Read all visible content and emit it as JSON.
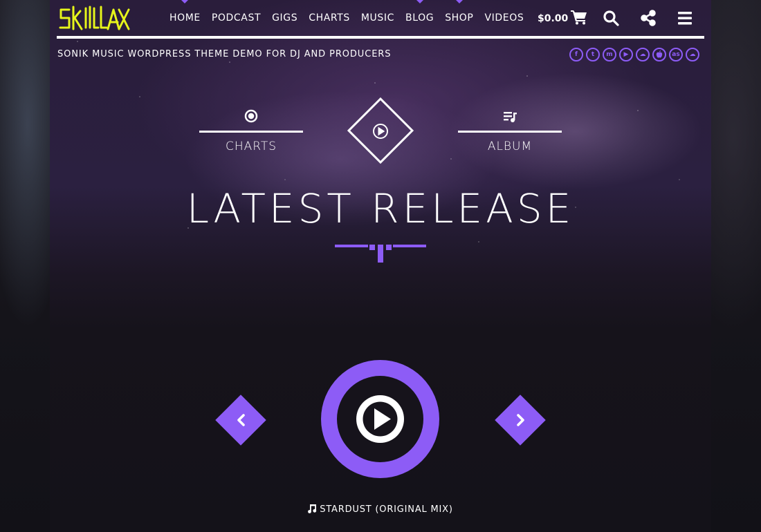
{
  "brand": {
    "logo_text": "SKILLAX"
  },
  "nav": {
    "items": [
      {
        "label": "HOME",
        "marked": true
      },
      {
        "label": "PODCAST",
        "marked": false
      },
      {
        "label": "GIGS",
        "marked": false
      },
      {
        "label": "CHARTS",
        "marked": false
      },
      {
        "label": "MUSIC",
        "marked": false
      },
      {
        "label": "BLOG",
        "marked": true
      },
      {
        "label": "SHOP",
        "marked": true
      },
      {
        "label": "VIDEOS",
        "marked": false
      }
    ]
  },
  "cart": {
    "total": "$0.00",
    "icon": "cart-icon"
  },
  "header_icons": [
    "search-icon",
    "share-icon",
    "menu-icon"
  ],
  "tagline": "SONIK MUSIC WORDPRESS THEME DEMO FOR DJ AND PRODUCERS",
  "socials": [
    {
      "name": "facebook-icon",
      "glyph": "f"
    },
    {
      "name": "twitter-icon",
      "glyph": "t"
    },
    {
      "name": "mixcloud-icon",
      "glyph": "m"
    },
    {
      "name": "youtube-icon",
      "glyph": "▶"
    },
    {
      "name": "soundcloud-icon",
      "glyph": "☁"
    },
    {
      "name": "apple-icon",
      "glyph": ""
    },
    {
      "name": "lastfm-icon",
      "glyph": "as"
    },
    {
      "name": "soundcloud-alt-icon",
      "glyph": "☁"
    }
  ],
  "sections": {
    "left": {
      "label": "CHARTS",
      "icon": "target-icon"
    },
    "center": {
      "icon": "play-circle-icon"
    },
    "right": {
      "label": "ALBUM",
      "icon": "playlist-icon"
    }
  },
  "hero": {
    "title": "LATEST RELEASE"
  },
  "player": {
    "track": "STARDUST (ORIGINAL MIX)",
    "prev_icon": "chevron-left-icon",
    "next_icon": "chevron-right-icon",
    "play_icon": "play-icon"
  },
  "colors": {
    "accent": "#8d5cf6",
    "logo": "#e6f51b",
    "text": "#ffffff"
  }
}
